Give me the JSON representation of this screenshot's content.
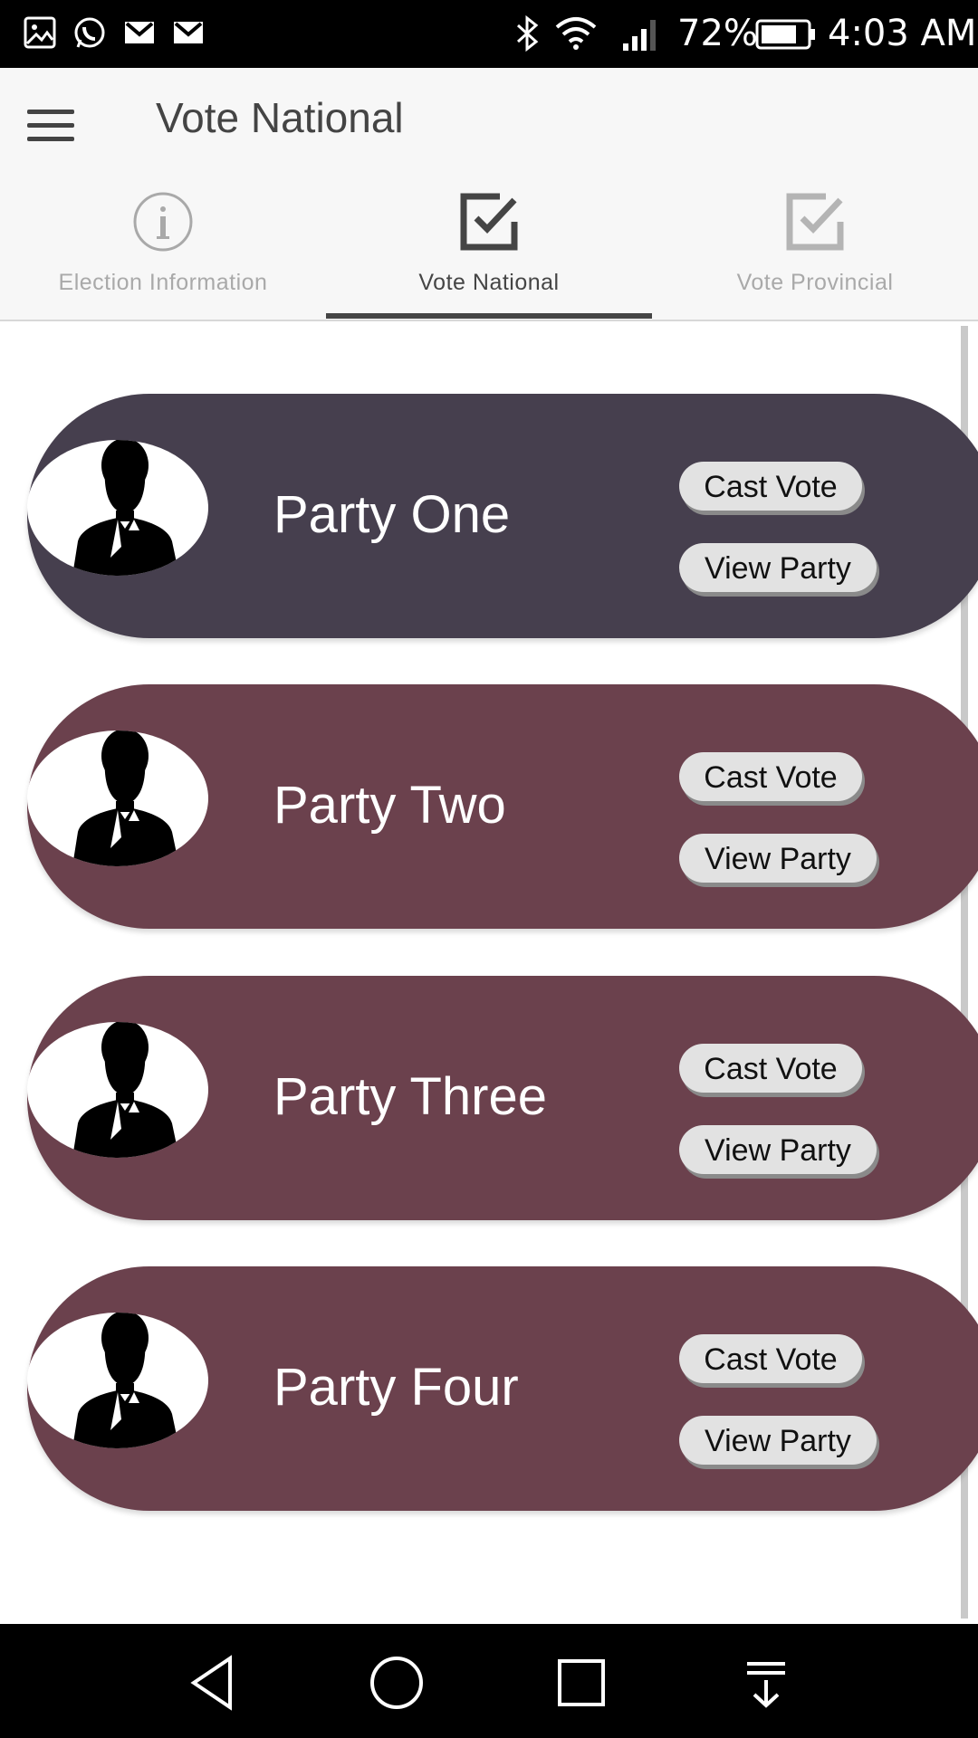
{
  "status_bar": {
    "battery_percent": "72%",
    "time": "4:03 AM",
    "left_icons": [
      "gallery-icon",
      "whatsapp-icon",
      "gmail-icon",
      "gmail-icon"
    ],
    "right_icons": [
      "bluetooth-icon",
      "wifi-icon",
      "signal-icon",
      "battery-icon"
    ]
  },
  "app_bar": {
    "title": "Vote National",
    "menu_icon": "hamburger-menu-icon"
  },
  "tabs": [
    {
      "label": "Election Information",
      "icon": "info-icon",
      "selected": false
    },
    {
      "label": "Vote National",
      "icon": "checkbox-icon",
      "selected": true
    },
    {
      "label": "Vote Provincial",
      "icon": "checkbox-icon",
      "selected": false
    }
  ],
  "parties": [
    {
      "name": "Party One",
      "color": "#463f4e",
      "cast_label": "Cast Vote",
      "view_label": "View Party"
    },
    {
      "name": "Party Two",
      "color": "#6b414d",
      "cast_label": "Cast Vote",
      "view_label": "View Party"
    },
    {
      "name": "Party Three",
      "color": "#6b414d",
      "cast_label": "Cast Vote",
      "view_label": "View Party"
    },
    {
      "name": "Party Four",
      "color": "#6b414d",
      "cast_label": "Cast Vote",
      "view_label": "View Party"
    }
  ],
  "colors": {
    "tab_selected": "#454545",
    "tab_unselected": "#a9a9a9",
    "app_bar_bg": "#f7f7f7"
  },
  "nav_bar": [
    "back-icon",
    "home-icon",
    "recents-icon",
    "notification-pulldown-icon"
  ]
}
